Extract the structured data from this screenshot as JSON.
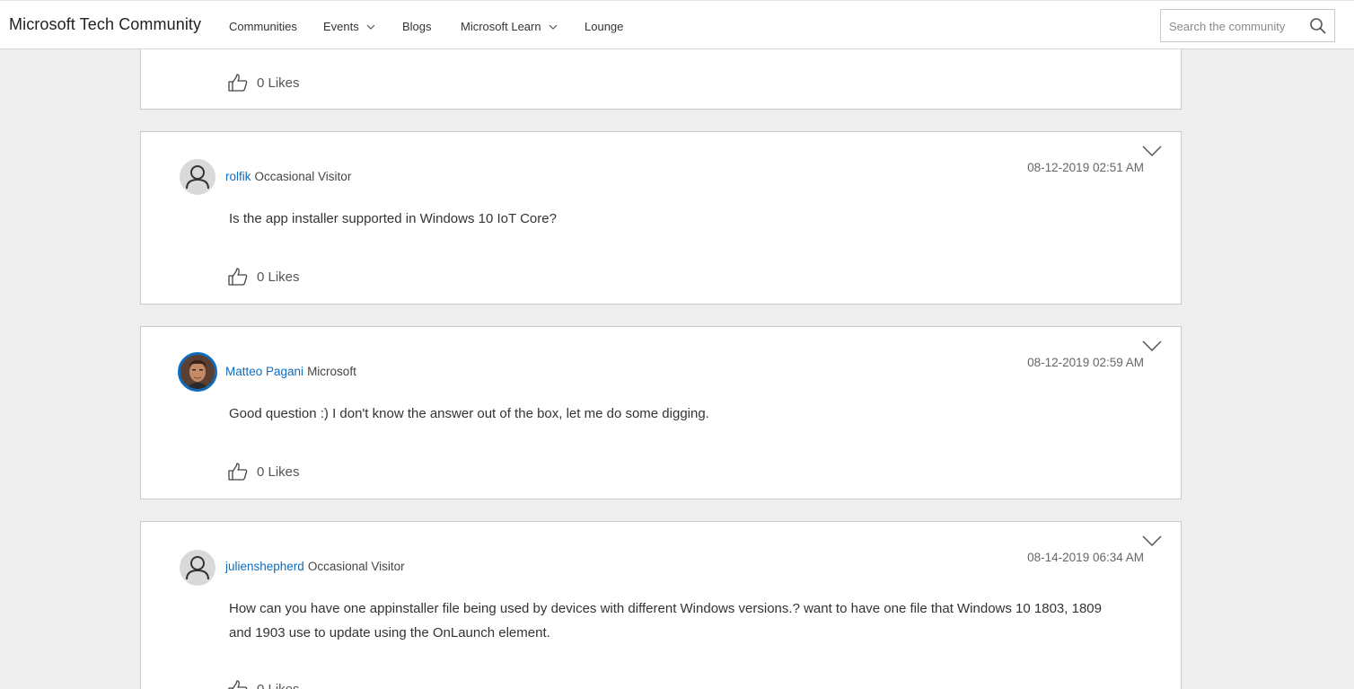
{
  "header": {
    "brand": "Microsoft Tech Community",
    "nav": [
      {
        "label": "Communities",
        "dropdown": false
      },
      {
        "label": "Events",
        "dropdown": true
      },
      {
        "label": "Blogs",
        "dropdown": false
      },
      {
        "label": "Microsoft Learn",
        "dropdown": true
      },
      {
        "label": "Lounge",
        "dropdown": false
      }
    ],
    "search": {
      "placeholder": "Search the community",
      "icon": "search-icon"
    }
  },
  "posts": [
    {
      "likes": "0 Likes"
    },
    {
      "author": "rolfik",
      "rank": "Occasional Visitor",
      "avatar": "default-user-icon",
      "date": "08-12-2019 02:51 AM",
      "body": "Is the app installer supported in Windows 10 IoT Core?",
      "likes": "0 Likes"
    },
    {
      "author": "Matteo Pagani",
      "rank": "Microsoft",
      "avatar": "user-photo",
      "date": "08-12-2019 02:59 AM",
      "body": "Good question :) I don't know the answer out of the box, let me do some digging.",
      "likes": "0 Likes"
    },
    {
      "author": "julienshepherd",
      "rank": "Occasional Visitor",
      "avatar": "default-user-icon",
      "date": "08-14-2019 06:34 AM",
      "body": "How can you have one appinstaller file being used by devices with different Windows versions.? want to have one file that Windows 10 1803, 1809 and 1903 use to update using the OnLaunch element.",
      "likes": "0 Likes"
    }
  ],
  "colors": {
    "link": "#0f6cbd",
    "page_bg": "#efeeee",
    "card_border": "#c9c9c9"
  }
}
